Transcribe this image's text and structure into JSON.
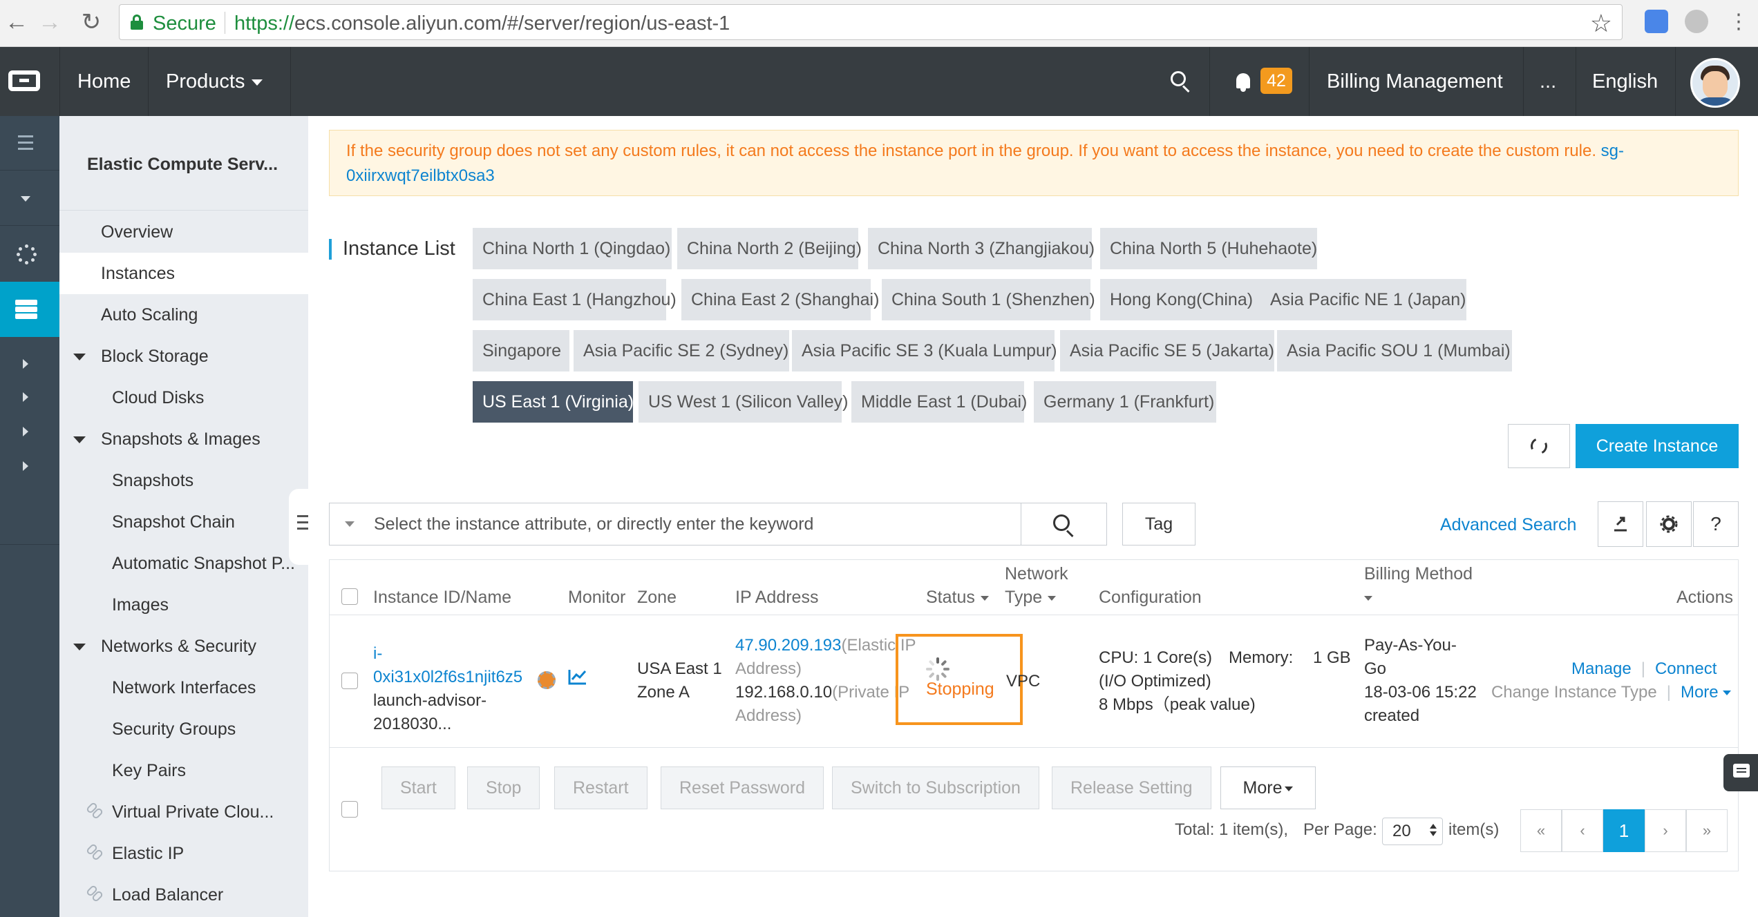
{
  "browser": {
    "secure_label": "Secure",
    "url_scheme": "https://",
    "url_rest": "ecs.console.aliyun.com/#/server/region/us-east-1"
  },
  "header": {
    "home": "Home",
    "products": "Products",
    "notification_count": "42",
    "billing": "Billing Management",
    "more": "...",
    "language": "English"
  },
  "sidebar": {
    "title": "Elastic Compute Serv...",
    "items": [
      {
        "label": "Overview"
      },
      {
        "label": "Instances"
      },
      {
        "label": "Auto Scaling"
      },
      {
        "label": "Block Storage"
      },
      {
        "label": "Cloud Disks"
      },
      {
        "label": "Snapshots & Images"
      },
      {
        "label": "Snapshots"
      },
      {
        "label": "Snapshot Chain"
      },
      {
        "label": "Automatic Snapshot P..."
      },
      {
        "label": "Images"
      },
      {
        "label": "Networks & Security"
      },
      {
        "label": "Network Interfaces"
      },
      {
        "label": "Security Groups"
      },
      {
        "label": "Key Pairs"
      },
      {
        "label": "Virtual Private Clou..."
      },
      {
        "label": "Elastic IP"
      },
      {
        "label": "Load Balancer"
      }
    ]
  },
  "notice": {
    "text": "If the security group does not set any custom rules, it can not access the instance port in the group. If you want to access the instance, you need to create the custom rule.",
    "sg_line1": "sg-",
    "sg_line2": "0xiirxwqt7eilbtx0sa3"
  },
  "instance_list": {
    "title": "Instance List",
    "regions": [
      "China North 1 (Qingdao)",
      "China North 2 (Beijing)",
      "China North 3 (Zhangjiakou)",
      "China North 5 (Huhehaote)",
      "China East 1 (Hangzhou)",
      "China East 2 (Shanghai)",
      "China South 1 (Shenzhen)",
      "Hong Kong(China)",
      "Asia Pacific NE 1 (Japan)",
      "Singapore",
      "Asia Pacific SE 2 (Sydney)",
      "Asia Pacific SE 3 (Kuala Lumpur)",
      "Asia Pacific SE 5 (Jakarta)",
      "Asia Pacific SOU 1 (Mumbai)",
      "US East 1 (Virginia)",
      "US West 1 (Silicon Valley)",
      "Middle East 1 (Dubai)",
      "Germany 1 (Frankfurt)"
    ],
    "selected_region": "US East 1 (Virginia)",
    "create_button": "Create Instance"
  },
  "search": {
    "placeholder": "Select the instance attribute, or directly enter the keyword",
    "tag_button": "Tag",
    "advanced": "Advanced Search",
    "help": "?"
  },
  "table": {
    "columns": {
      "id_name": "Instance ID/Name",
      "monitor": "Monitor",
      "zone": "Zone",
      "ip": "IP Address",
      "status": "Status",
      "network_type_1": "Network",
      "network_type_2": "Type",
      "configuration": "Configuration",
      "billing": "Billing Method",
      "actions": "Actions"
    },
    "row": {
      "id_1": "i-",
      "id_2": "0xi31x0l2f6s1njit6z5",
      "name_1": "launch-advisor-",
      "name_2": "2018030...",
      "zone_1": "USA East 1",
      "zone_2": "Zone A",
      "ip_elastic": "47.90.209.193",
      "ip_elastic_label_1": "(Elastic IP",
      "ip_elastic_label_2": "Address)",
      "ip_private": "192.168.0.10",
      "ip_private_label_1": "(Private IP",
      "ip_private_label_2": "Address)",
      "status": "Stopping",
      "network_type": "VPC",
      "cpu": "CPU: 1 Core(s)",
      "memory_label": "Memory:",
      "memory_value": "1 GB",
      "io": "(I/O Optimized)",
      "bandwidth": "8 Mbps（peak value)",
      "billing_1": "Pay-As-You-",
      "billing_2": "Go",
      "created_1": "18-03-06 15:22",
      "created_2": "created",
      "manage": "Manage",
      "connect": "Connect",
      "change_type": "Change Instance Type",
      "more": "More"
    }
  },
  "bulk_actions": {
    "start": "Start",
    "stop": "Stop",
    "restart": "Restart",
    "reset_password": "Reset Password",
    "switch_subscription": "Switch to Subscription",
    "release_setting": "Release Setting",
    "more": "More"
  },
  "pagination": {
    "total": "Total: 1 item(s),",
    "per_page_label": "Per Page:",
    "per_page_value": "20",
    "items_suffix": "item(s)",
    "first": "«",
    "prev": "‹",
    "current": "1",
    "next": "›",
    "last": "»"
  },
  "colors": {
    "accent": "#0fa0db",
    "warning": "#f47a1d",
    "header_bg": "#373d41"
  }
}
